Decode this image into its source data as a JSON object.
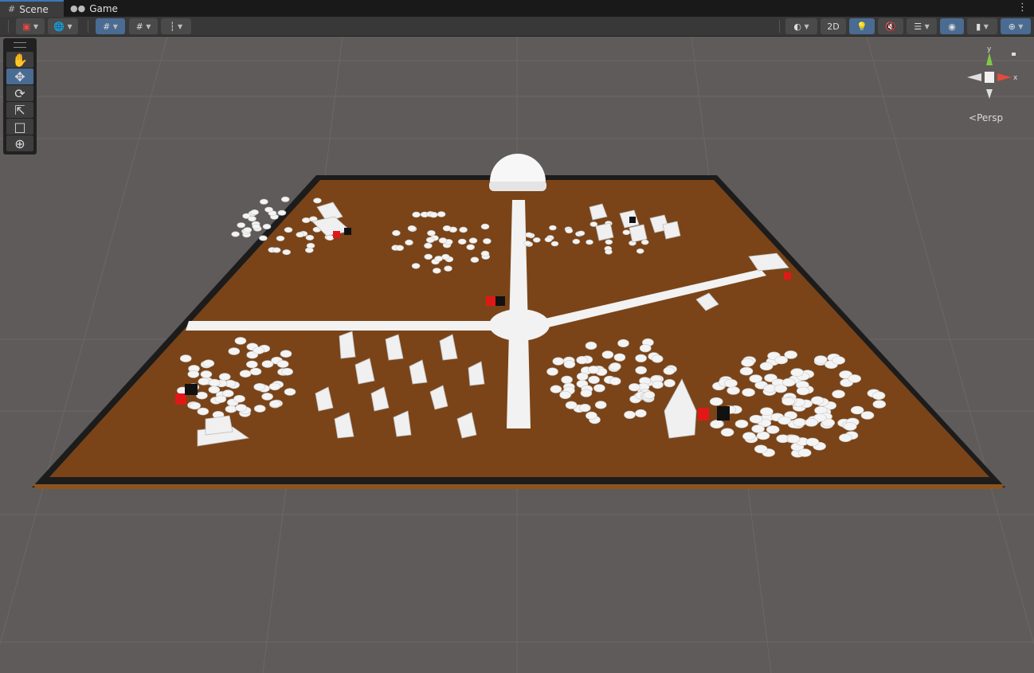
{
  "tabs": [
    {
      "label": "Scene",
      "icon": "grid-icon",
      "active": true
    },
    {
      "label": "Game",
      "icon": "gamepad-icon",
      "active": false
    }
  ],
  "toolbar": {
    "left": [
      "draw-mode-icon",
      "global-view-icon",
      "grid-snap-icon",
      "increment-snap-icon",
      "ruler-icon"
    ],
    "right": [
      "shading-mode-icon",
      "lighting-icon",
      "audio-mute-icon",
      "effects-icon",
      "scene-visibility-icon",
      "camera-icon",
      "gizmos-icon"
    ],
    "mode_2d_label": "2D"
  },
  "tools": [
    {
      "name": "hand-tool",
      "icon": "hand-icon",
      "active": false
    },
    {
      "name": "move-tool",
      "icon": "move-icon",
      "active": true
    },
    {
      "name": "rotate-tool",
      "icon": "rotate-icon",
      "active": false
    },
    {
      "name": "scale-tool",
      "icon": "scale-icon",
      "active": false
    },
    {
      "name": "rect-tool",
      "icon": "rect-icon",
      "active": false
    },
    {
      "name": "transform-tool",
      "icon": "transform-icon",
      "active": false
    }
  ],
  "gizmo": {
    "y_label": "y",
    "x_label": "x",
    "projection_label": "Persp"
  },
  "colors": {
    "ground": "#7a4418",
    "border": "#1c1c1c",
    "object": "#f2f2f2",
    "accent_red": "#e11818",
    "accent_blue": "#4a6b92"
  }
}
